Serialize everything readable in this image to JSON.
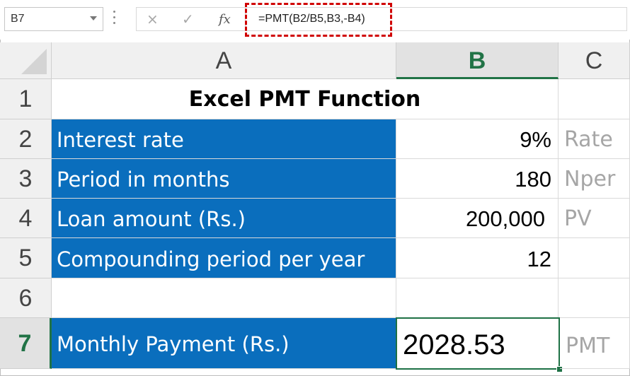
{
  "formula_bar": {
    "name_box": "B7",
    "cancel_icon": "×",
    "enter_icon": "✓",
    "fx_label": "fx",
    "formula": "=PMT(B2/B5,B3,-B4)"
  },
  "columns": [
    "A",
    "B",
    "C"
  ],
  "rows": [
    "1",
    "2",
    "3",
    "4",
    "5",
    "6",
    "7"
  ],
  "selected_cell": "B7",
  "cells": {
    "title": "Excel PMT Function",
    "A2": "Interest rate",
    "B2": "9%",
    "C2": "Rate",
    "A3": "Period in months",
    "B3": "180",
    "C3": "Nper",
    "A4": "Loan amount (Rs.)",
    "B4": "200,000",
    "C4": "PV",
    "A5": "Compounding period per year",
    "B5": "12",
    "A7": "Monthly Payment (Rs.)",
    "B7": "2028.53",
    "C7": "PMT"
  },
  "colors": {
    "label_fill": "#0a6ebd",
    "selection_green": "#217346",
    "annotation_gray": "#a6a6a6",
    "highlight_red": "#d00000"
  }
}
